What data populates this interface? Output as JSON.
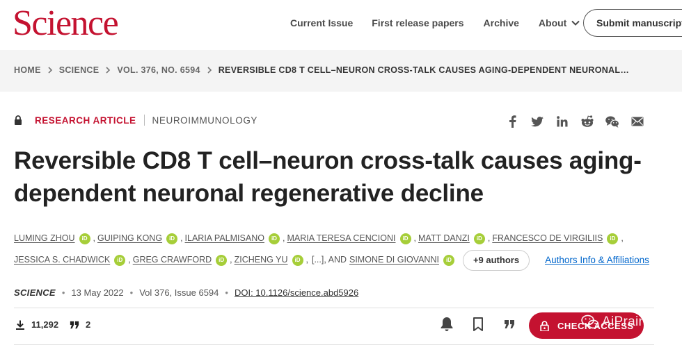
{
  "header": {
    "logo": "Science",
    "nav": [
      {
        "label": "Current Issue"
      },
      {
        "label": "First release papers"
      },
      {
        "label": "Archive"
      },
      {
        "label": "About"
      }
    ],
    "submit_label": "Submit manuscript"
  },
  "breadcrumb": {
    "items": [
      "HOME",
      "SCIENCE",
      "VOL. 376, NO. 6594",
      "REVERSIBLE CD8 T CELL–NEURON CROSS-TALK CAUSES AGING-DEPENDENT NEURONAL…"
    ]
  },
  "article": {
    "type": "RESEARCH ARTICLE",
    "subject": "NEUROIMMUNOLOGY",
    "title": "Reversible CD8 T cell–neuron cross-talk causes aging-dependent neuronal regenerative decline",
    "authors_line1": [
      "LUMING ZHOU",
      "GUIPING KONG",
      "ILARIA PALMISANO",
      "MARIA TERESA CENCIONI",
      "MATT DANZI",
      "FRANCESCO DE VIRGILIIS"
    ],
    "authors_line2": [
      "JESSICA S. CHADWICK",
      "GREG CRAWFORD",
      "ZICHENG YU"
    ],
    "ellipsis": "[...], AND",
    "last_author": "SIMONE DI GIOVANNI",
    "more_authors_label": "+9 authors",
    "affiliations_label": "Authors Info & Affiliations",
    "orcid_label": "iD"
  },
  "citation": {
    "journal": "SCIENCE",
    "date": "13 May 2022",
    "volume": "Vol 376, Issue 6594",
    "doi": "DOI: 10.1126/science.abd5926"
  },
  "metrics": {
    "downloads": "11,292",
    "citations": "2"
  },
  "actions": {
    "check_access_label": "CHECK ACCESS"
  },
  "watermark": {
    "text": "AiPrain"
  },
  "colors": {
    "brand": "#c41230",
    "link": "#0066cc",
    "orcid": "#a6ce39"
  }
}
